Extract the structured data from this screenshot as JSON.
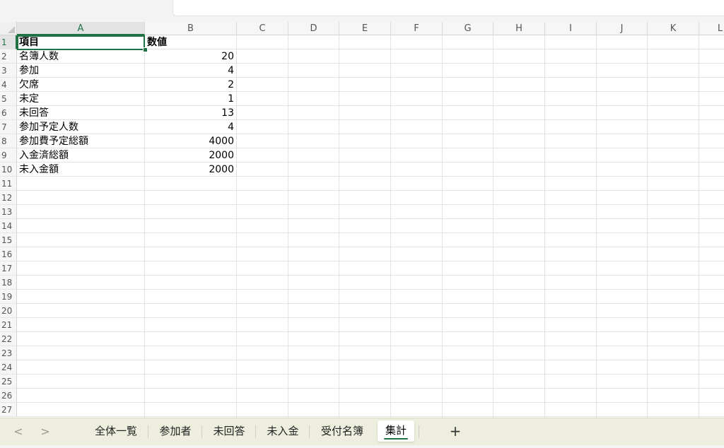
{
  "columns": [
    "A",
    "B",
    "C",
    "D",
    "E",
    "F",
    "G",
    "H",
    "I",
    "J",
    "K",
    "L"
  ],
  "selected_column": "A",
  "selected_row": "1",
  "rows": [
    "1",
    "2",
    "3",
    "4",
    "5",
    "6",
    "7",
    "8",
    "9",
    "10",
    "11",
    "12",
    "13",
    "14",
    "15",
    "16",
    "17",
    "18",
    "19",
    "20",
    "21",
    "22",
    "23",
    "24",
    "25",
    "26",
    "27"
  ],
  "cells": [
    {
      "row": "1",
      "a": "項目",
      "b": "数値",
      "header": true
    },
    {
      "row": "2",
      "a": "名簿人数",
      "b": "20"
    },
    {
      "row": "3",
      "a": "参加",
      "b": "4"
    },
    {
      "row": "4",
      "a": "欠席",
      "b": "2"
    },
    {
      "row": "5",
      "a": "未定",
      "b": "1"
    },
    {
      "row": "6",
      "a": "未回答",
      "b": "13"
    },
    {
      "row": "7",
      "a": "参加予定人数",
      "b": "4"
    },
    {
      "row": "8",
      "a": "参加費予定総額",
      "b": "4000"
    },
    {
      "row": "9",
      "a": "入金済総額",
      "b": "2000"
    },
    {
      "row": "10",
      "a": "未入金額",
      "b": "2000"
    }
  ],
  "sheet_tabs": [
    {
      "label": "全体一覧",
      "active": false
    },
    {
      "label": "参加者",
      "active": false
    },
    {
      "label": "未回答",
      "active": false
    },
    {
      "label": "未入金",
      "active": false
    },
    {
      "label": "受付名簿",
      "active": false
    },
    {
      "label": "集計",
      "active": true
    }
  ],
  "tab_nav": {
    "prev": "<",
    "next": ">",
    "prev_icon": "chevron-left-icon",
    "next_icon": "chevron-right-icon"
  },
  "add_sheet_label": "+",
  "colors": {
    "accent": "#217346",
    "tabbar_bg": "#eeeede",
    "header_bg": "#f6f6f6"
  }
}
